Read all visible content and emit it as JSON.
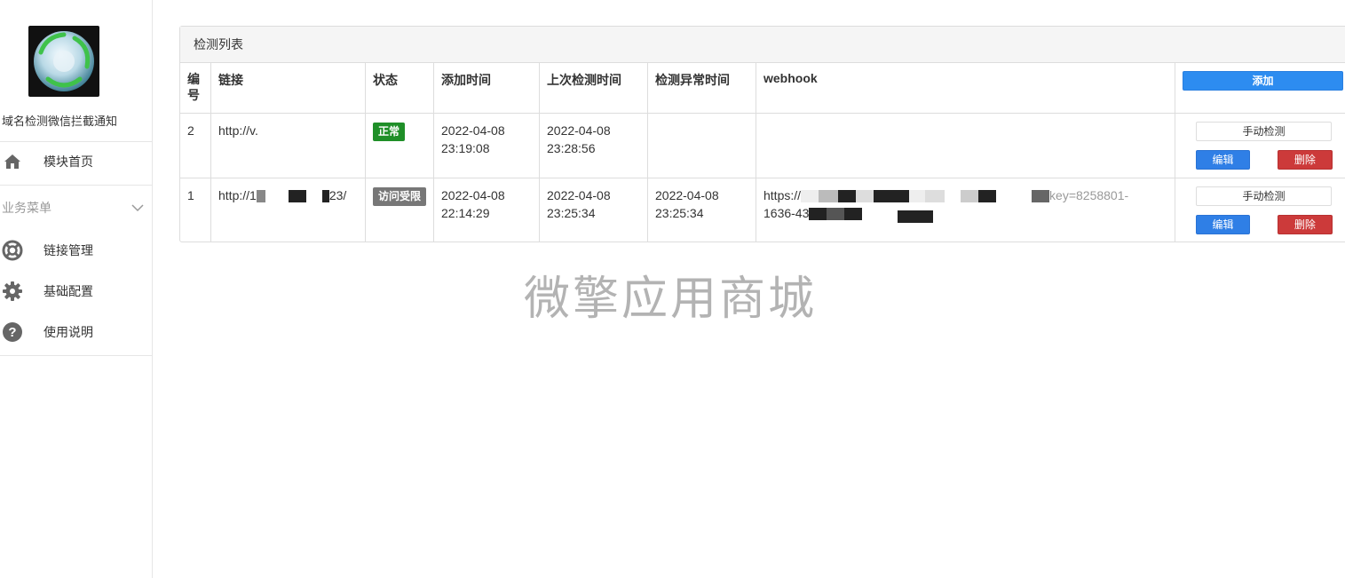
{
  "sidebar": {
    "app_name": "域名检测微信拦截通知",
    "home_label": "模块首页",
    "group_title": "业务菜单",
    "items": [
      {
        "label": "链接管理",
        "icon": "lifebuoy-icon"
      },
      {
        "label": "基础配置",
        "icon": "gear-icon"
      },
      {
        "label": "使用说明",
        "icon": "question-icon"
      }
    ]
  },
  "panel": {
    "title": "检测列表",
    "headers": [
      "编号",
      "链接",
      "状态",
      "添加时间",
      "上次检测时间",
      "检测异常时间",
      "webhook"
    ],
    "add_label": "添加",
    "rows": [
      {
        "id": "2",
        "link": "http://v.",
        "status": "正常",
        "status_color": "#1f8f28",
        "added": "2022-04-08 23:19:08",
        "last_check": "2022-04-08 23:28:56",
        "error_time": "",
        "webhook_line1": "",
        "webhook_line2": "",
        "check_label": "手动检测",
        "edit_label": "编辑",
        "delete_label": "删除"
      },
      {
        "id": "1",
        "link_start": "http://1",
        "link_end": "23/",
        "status": "访问受限",
        "status_color": "#777777",
        "added": "2022-04-08 22:14:29",
        "last_check": "2022-04-08 23:25:34",
        "error_time": "2022-04-08 23:25:34",
        "webhook_line1_start": "https://",
        "webhook_line1_end": "key=8258801-",
        "webhook_line2_start": "1636-43",
        "check_label": "手动检测",
        "edit_label": "编辑",
        "delete_label": "删除"
      }
    ]
  },
  "watermark": "微擎应用商城",
  "colors": {
    "primary": "#2d8cf0",
    "danger": "#cc3a3a",
    "success": "#1f8f28"
  }
}
